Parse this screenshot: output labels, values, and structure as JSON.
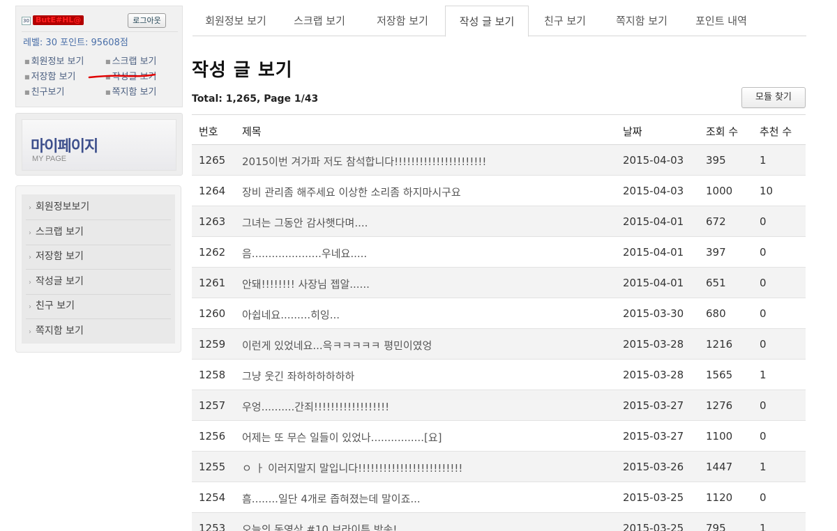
{
  "user": {
    "level_badge": "30",
    "nickname": "ButE#HL@",
    "logout_label": "로그아웃",
    "level_points": "레벨: 30   포인트: 95608점",
    "quick_links": [
      "회원정보 보기",
      "스크랩 보기",
      "저장함 보기",
      "작성글 보기",
      "친구보기",
      "쪽지함 보기"
    ]
  },
  "banner": {
    "title": "마이페이지",
    "subtitle": "MY PAGE"
  },
  "side_menu": {
    "items": [
      "회원정보보기",
      "스크랩 보기",
      "저장함 보기",
      "작성글 보기",
      "친구 보기",
      "쪽지함 보기"
    ]
  },
  "tabs": [
    {
      "label": "회원정보 보기",
      "active": false
    },
    {
      "label": "스크랩 보기",
      "active": false
    },
    {
      "label": "저장함 보기",
      "active": false
    },
    {
      "label": "작성 글 보기",
      "active": true
    },
    {
      "label": "친구 보기",
      "active": false
    },
    {
      "label": "쪽지함 보기",
      "active": false
    },
    {
      "label": "포인트 내역",
      "active": false
    }
  ],
  "main": {
    "title": "작성 글 보기",
    "total_line": "Total: 1,265, Page 1/43",
    "find_button": "모듈 찾기"
  },
  "board": {
    "columns": {
      "num": "번호",
      "title": "제목",
      "date": "날짜",
      "views": "조회 수",
      "recommends": "추천 수"
    },
    "rows": [
      {
        "num": "1265",
        "title": "2015이번 겨가파 저도 참석합니다!!!!!!!!!!!!!!!!!!!!!!",
        "date": "2015-04-03",
        "views": "395",
        "recommends": "1"
      },
      {
        "num": "1264",
        "title": "장비 관리좀 해주세요 이상한 소리좀 하지마시구요",
        "date": "2015-04-03",
        "views": "1000",
        "recommends": "10"
      },
      {
        "num": "1263",
        "title": "그녀는 그동안 감사햇다며....",
        "date": "2015-04-01",
        "views": "672",
        "recommends": "0"
      },
      {
        "num": "1262",
        "title": "음.....................우네요.....",
        "date": "2015-04-01",
        "views": "397",
        "recommends": "0"
      },
      {
        "num": "1261",
        "title": "안돼!!!!!!!! 사장님 젭알......",
        "date": "2015-04-01",
        "views": "651",
        "recommends": "0"
      },
      {
        "num": "1260",
        "title": "아쉽네요.........히잉...",
        "date": "2015-03-30",
        "views": "680",
        "recommends": "0"
      },
      {
        "num": "1259",
        "title": "이런게 있었네요...윽ㅋㅋㅋㅋㅋ 평민이였엉",
        "date": "2015-03-28",
        "views": "1216",
        "recommends": "0"
      },
      {
        "num": "1258",
        "title": "그냥 웃긴 좌하하하하하하",
        "date": "2015-03-28",
        "views": "1565",
        "recommends": "1"
      },
      {
        "num": "1257",
        "title": "우엉..........간죄!!!!!!!!!!!!!!!!!!",
        "date": "2015-03-27",
        "views": "1276",
        "recommends": "0"
      },
      {
        "num": "1256",
        "title": "어제는 또 무슨 일들이 있었나................[요]",
        "date": "2015-03-27",
        "views": "1100",
        "recommends": "0"
      },
      {
        "num": "1255",
        "title": "ㅇ ㅏ 이러지말지 말입니다!!!!!!!!!!!!!!!!!!!!!!!!!",
        "date": "2015-03-26",
        "views": "1447",
        "recommends": "1"
      },
      {
        "num": "1254",
        "title": "흠........일단 4개로 좁혀졌는데 말이죠...",
        "date": "2015-03-25",
        "views": "1120",
        "recommends": "0"
      },
      {
        "num": "1253",
        "title": "오늘의 동영상 #10 브라이튼 방송!",
        "date": "2015-03-25",
        "views": "795",
        "recommends": "1"
      }
    ]
  },
  "colors": {
    "accent_blue": "#4a6fa8",
    "banner_title": "#3d4f8c",
    "underline_red": "#e00000"
  }
}
